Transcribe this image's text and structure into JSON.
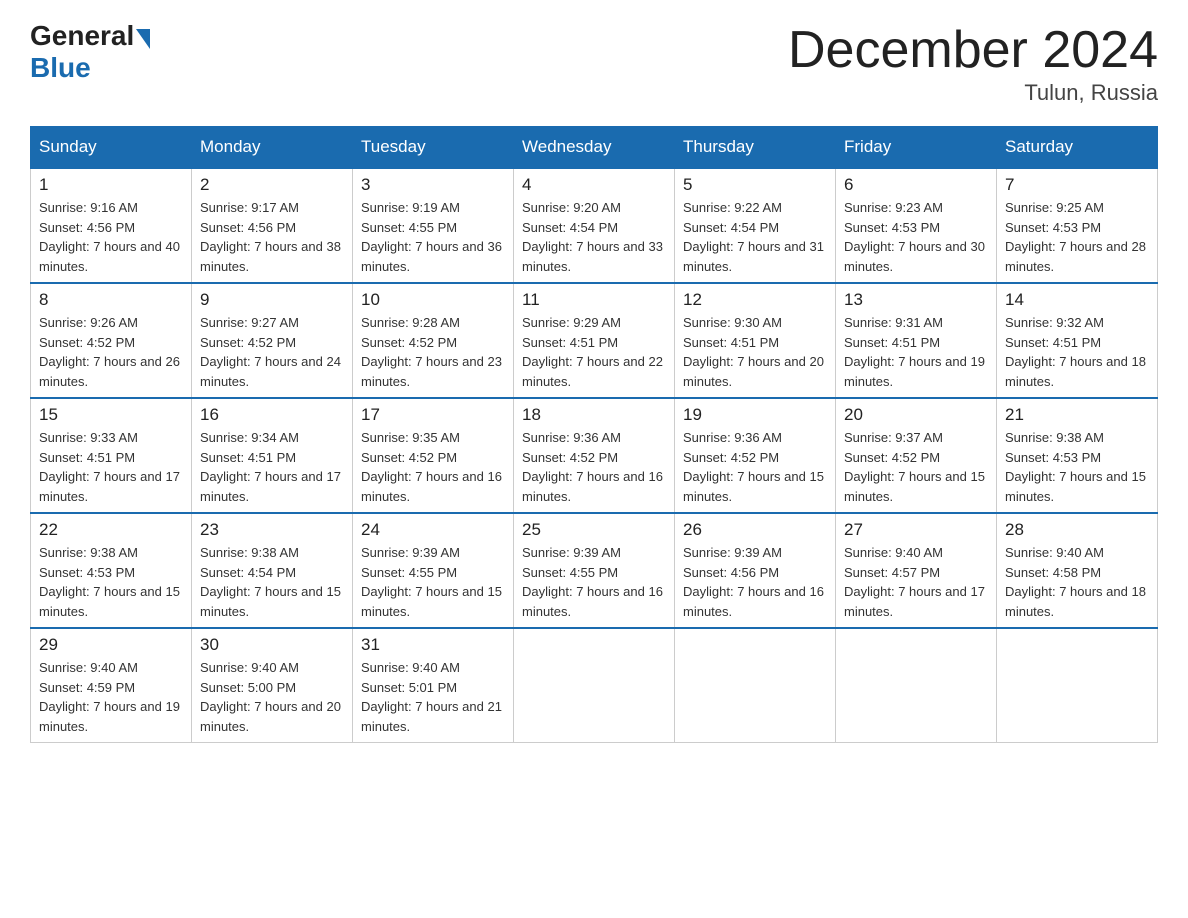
{
  "header": {
    "logo_general": "General",
    "logo_blue": "Blue",
    "month_title": "December 2024",
    "location": "Tulun, Russia"
  },
  "weekdays": [
    "Sunday",
    "Monday",
    "Tuesday",
    "Wednesday",
    "Thursday",
    "Friday",
    "Saturday"
  ],
  "weeks": [
    [
      {
        "day": "1",
        "sunrise": "9:16 AM",
        "sunset": "4:56 PM",
        "daylight": "7 hours and 40 minutes."
      },
      {
        "day": "2",
        "sunrise": "9:17 AM",
        "sunset": "4:56 PM",
        "daylight": "7 hours and 38 minutes."
      },
      {
        "day": "3",
        "sunrise": "9:19 AM",
        "sunset": "4:55 PM",
        "daylight": "7 hours and 36 minutes."
      },
      {
        "day": "4",
        "sunrise": "9:20 AM",
        "sunset": "4:54 PM",
        "daylight": "7 hours and 33 minutes."
      },
      {
        "day": "5",
        "sunrise": "9:22 AM",
        "sunset": "4:54 PM",
        "daylight": "7 hours and 31 minutes."
      },
      {
        "day": "6",
        "sunrise": "9:23 AM",
        "sunset": "4:53 PM",
        "daylight": "7 hours and 30 minutes."
      },
      {
        "day": "7",
        "sunrise": "9:25 AM",
        "sunset": "4:53 PM",
        "daylight": "7 hours and 28 minutes."
      }
    ],
    [
      {
        "day": "8",
        "sunrise": "9:26 AM",
        "sunset": "4:52 PM",
        "daylight": "7 hours and 26 minutes."
      },
      {
        "day": "9",
        "sunrise": "9:27 AM",
        "sunset": "4:52 PM",
        "daylight": "7 hours and 24 minutes."
      },
      {
        "day": "10",
        "sunrise": "9:28 AM",
        "sunset": "4:52 PM",
        "daylight": "7 hours and 23 minutes."
      },
      {
        "day": "11",
        "sunrise": "9:29 AM",
        "sunset": "4:51 PM",
        "daylight": "7 hours and 22 minutes."
      },
      {
        "day": "12",
        "sunrise": "9:30 AM",
        "sunset": "4:51 PM",
        "daylight": "7 hours and 20 minutes."
      },
      {
        "day": "13",
        "sunrise": "9:31 AM",
        "sunset": "4:51 PM",
        "daylight": "7 hours and 19 minutes."
      },
      {
        "day": "14",
        "sunrise": "9:32 AM",
        "sunset": "4:51 PM",
        "daylight": "7 hours and 18 minutes."
      }
    ],
    [
      {
        "day": "15",
        "sunrise": "9:33 AM",
        "sunset": "4:51 PM",
        "daylight": "7 hours and 17 minutes."
      },
      {
        "day": "16",
        "sunrise": "9:34 AM",
        "sunset": "4:51 PM",
        "daylight": "7 hours and 17 minutes."
      },
      {
        "day": "17",
        "sunrise": "9:35 AM",
        "sunset": "4:52 PM",
        "daylight": "7 hours and 16 minutes."
      },
      {
        "day": "18",
        "sunrise": "9:36 AM",
        "sunset": "4:52 PM",
        "daylight": "7 hours and 16 minutes."
      },
      {
        "day": "19",
        "sunrise": "9:36 AM",
        "sunset": "4:52 PM",
        "daylight": "7 hours and 15 minutes."
      },
      {
        "day": "20",
        "sunrise": "9:37 AM",
        "sunset": "4:52 PM",
        "daylight": "7 hours and 15 minutes."
      },
      {
        "day": "21",
        "sunrise": "9:38 AM",
        "sunset": "4:53 PM",
        "daylight": "7 hours and 15 minutes."
      }
    ],
    [
      {
        "day": "22",
        "sunrise": "9:38 AM",
        "sunset": "4:53 PM",
        "daylight": "7 hours and 15 minutes."
      },
      {
        "day": "23",
        "sunrise": "9:38 AM",
        "sunset": "4:54 PM",
        "daylight": "7 hours and 15 minutes."
      },
      {
        "day": "24",
        "sunrise": "9:39 AM",
        "sunset": "4:55 PM",
        "daylight": "7 hours and 15 minutes."
      },
      {
        "day": "25",
        "sunrise": "9:39 AM",
        "sunset": "4:55 PM",
        "daylight": "7 hours and 16 minutes."
      },
      {
        "day": "26",
        "sunrise": "9:39 AM",
        "sunset": "4:56 PM",
        "daylight": "7 hours and 16 minutes."
      },
      {
        "day": "27",
        "sunrise": "9:40 AM",
        "sunset": "4:57 PM",
        "daylight": "7 hours and 17 minutes."
      },
      {
        "day": "28",
        "sunrise": "9:40 AM",
        "sunset": "4:58 PM",
        "daylight": "7 hours and 18 minutes."
      }
    ],
    [
      {
        "day": "29",
        "sunrise": "9:40 AM",
        "sunset": "4:59 PM",
        "daylight": "7 hours and 19 minutes."
      },
      {
        "day": "30",
        "sunrise": "9:40 AM",
        "sunset": "5:00 PM",
        "daylight": "7 hours and 20 minutes."
      },
      {
        "day": "31",
        "sunrise": "9:40 AM",
        "sunset": "5:01 PM",
        "daylight": "7 hours and 21 minutes."
      },
      null,
      null,
      null,
      null
    ]
  ]
}
